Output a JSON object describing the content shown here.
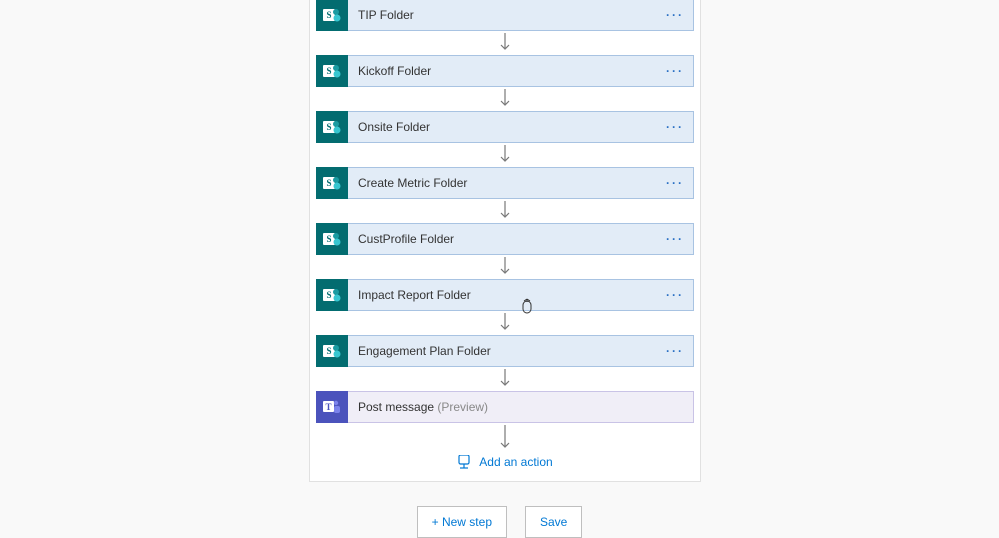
{
  "steps": [
    {
      "label": "TIP Folder",
      "type": "sharepoint",
      "preview": ""
    },
    {
      "label": "Kickoff Folder",
      "type": "sharepoint",
      "preview": ""
    },
    {
      "label": "Onsite Folder",
      "type": "sharepoint",
      "preview": ""
    },
    {
      "label": "Create Metric Folder",
      "type": "sharepoint",
      "preview": ""
    },
    {
      "label": "CustProfile Folder",
      "type": "sharepoint",
      "preview": ""
    },
    {
      "label": "Impact Report Folder",
      "type": "sharepoint",
      "preview": ""
    },
    {
      "label": "Engagement Plan Folder",
      "type": "sharepoint",
      "preview": ""
    },
    {
      "label": "Post message ",
      "type": "teams",
      "preview": "(Preview)"
    }
  ],
  "add_action_label": "Add an action",
  "footer": {
    "new_step": "+ New step",
    "save": "Save"
  }
}
